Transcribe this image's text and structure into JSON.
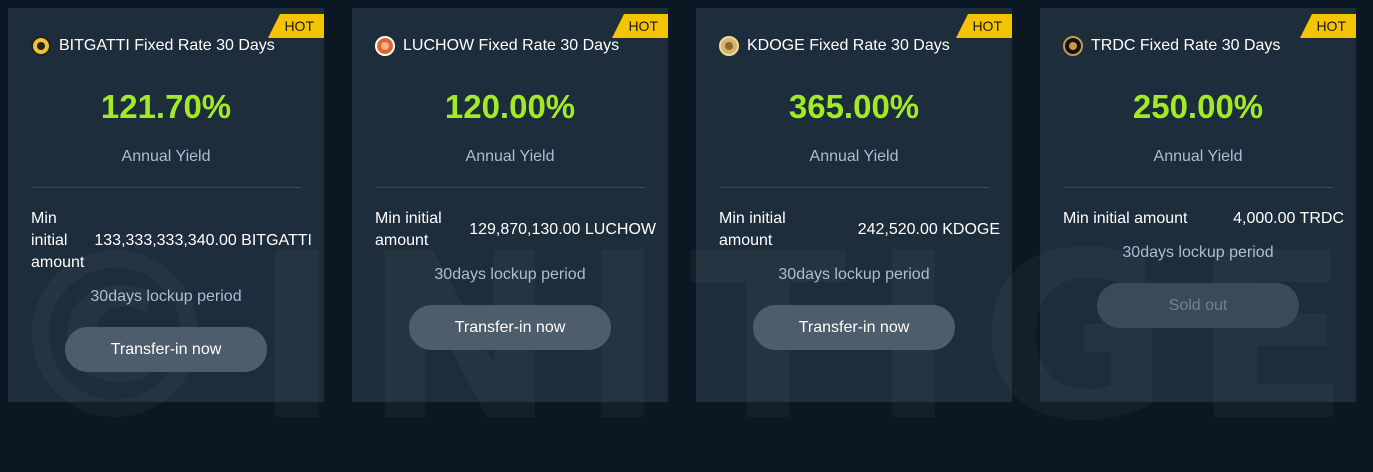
{
  "watermark": "©INITIGER",
  "cards": [
    {
      "badge": "HOT",
      "coin_icon": "bitgatti-coin-icon",
      "title": "BITGATTI Fixed Rate 30 Days",
      "rate": "121.70%",
      "rate_label": "Annual Yield",
      "min_label": "Min initial amount",
      "min_value": "133,333,333,340.00 BITGATTI",
      "lockup": "30days lockup period",
      "button": "Transfer-in now"
    },
    {
      "badge": "HOT",
      "coin_icon": "luchow-coin-icon",
      "title": "LUCHOW Fixed Rate 30 Days",
      "rate": "120.00%",
      "rate_label": "Annual Yield",
      "min_label": "Min initial amount",
      "min_value": "129,870,130.00 LUCHOW",
      "lockup": "30days lockup period",
      "button": "Transfer-in now"
    },
    {
      "badge": "HOT",
      "coin_icon": "kdoge-coin-icon",
      "title": "KDOGE Fixed Rate 30 Days",
      "rate": "365.00%",
      "rate_label": "Annual Yield",
      "min_label": "Min initial amount",
      "min_value": "242,520.00 KDOGE",
      "lockup": "30days lockup period",
      "button": "Transfer-in now"
    },
    {
      "badge": "HOT",
      "coin_icon": "trdc-coin-icon",
      "title": "TRDC Fixed Rate 30 Days",
      "rate": "250.00%",
      "rate_label": "Annual Yield",
      "min_label": "Min initial amount",
      "min_value": "4,000.00 TRDC",
      "lockup": "30days lockup period",
      "button": "Sold out"
    }
  ],
  "colors": {
    "background": "#0b1722",
    "card": "#1e2d3b",
    "rate_green": "#a2ea26",
    "hot_badge": "#f5c400",
    "button": "#4d5d6c",
    "button_disabled": "#3a4a58"
  }
}
